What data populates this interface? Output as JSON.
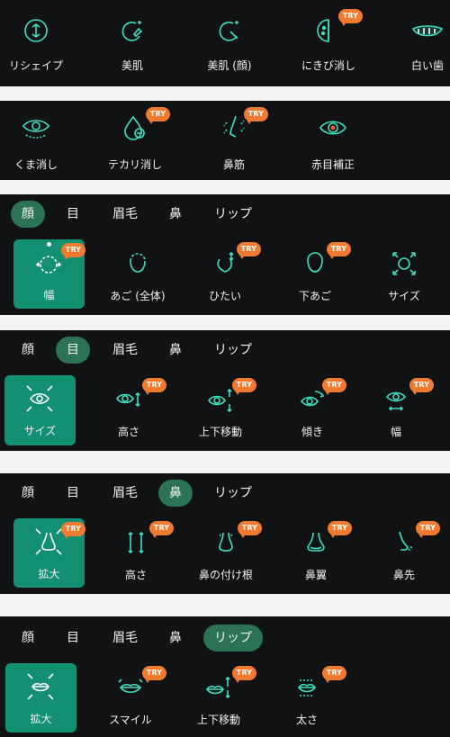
{
  "row1": [
    "リシェイプ",
    "美肌",
    "美肌 (顔)",
    "にきび消し",
    "白い歯"
  ],
  "row2": [
    "くま消し",
    "テカリ消し",
    "鼻筋",
    "赤目補正"
  ],
  "try_label": "TRY",
  "tabs": [
    "顔",
    "目",
    "眉毛",
    "鼻",
    "リップ"
  ],
  "face": [
    "幅",
    "あご (全体)",
    "ひたい",
    "下あご",
    "サイズ"
  ],
  "eye": [
    "サイズ",
    "高さ",
    "上下移動",
    "傾き",
    "幅"
  ],
  "nose": [
    "拡大",
    "高さ",
    "鼻の付け根",
    "鼻翼",
    "鼻先"
  ],
  "lip": [
    "拡大",
    "スマイル",
    "上下移動",
    "太さ"
  ],
  "colors": {
    "accent": "#3ee0c0",
    "selected_bg": "#138f71",
    "active_tab": "#2c7355",
    "try_badge": "#ef7a30",
    "panel_bg": "#101213"
  }
}
